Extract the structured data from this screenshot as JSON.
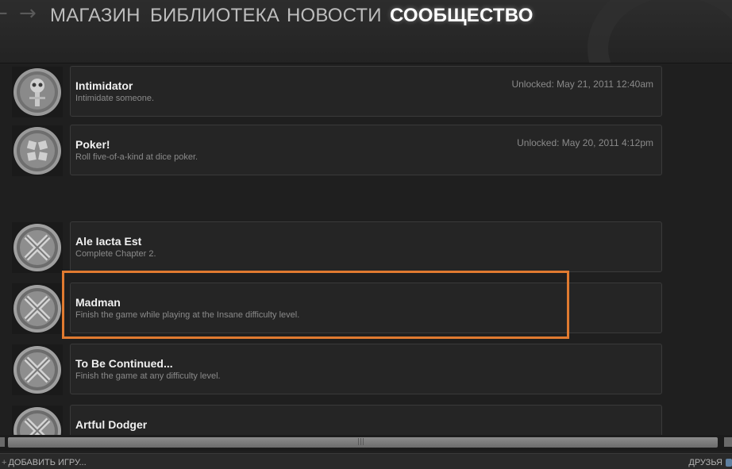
{
  "nav": {
    "back_icon": "←",
    "forward_icon": "→",
    "tabs": [
      {
        "label": "МАГАЗИН",
        "active": false
      },
      {
        "label": "БИБЛИОТЕКА",
        "active": false
      },
      {
        "label": "НОВОСТИ",
        "active": false
      },
      {
        "label": "СООБЩЕСТВО",
        "active": true
      }
    ]
  },
  "achievements": [
    {
      "name": "Intimidator",
      "description": "Intimidate someone.",
      "unlocked": "Unlocked: May 21, 2011 12:40am",
      "icon": "skull-medal-icon"
    },
    {
      "name": "Poker!",
      "description": "Roll five-of-a-kind at dice poker.",
      "unlocked": "Unlocked: May 20, 2011 4:12pm",
      "icon": "dice-medal-icon"
    },
    {
      "name": "Ale Iacta Est",
      "description": "Complete Chapter 2.",
      "unlocked": "",
      "icon": "chapter-medal-icon"
    },
    {
      "name": "Madman",
      "description": "Finish the game while playing at the Insane difficulty level.",
      "unlocked": "",
      "icon": "chapter-medal-icon"
    },
    {
      "name": "To Be Continued...",
      "description": "Finish the game at any difficulty level.",
      "unlocked": "",
      "icon": "chapter-medal-icon"
    },
    {
      "name": "Artful Dodger",
      "description": "",
      "unlocked": "",
      "icon": "chapter-medal-icon"
    }
  ],
  "highlight_color": "#e07a30",
  "bottom": {
    "add_game": "ДОБАВИТЬ ИГРУ...",
    "add_icon": "+",
    "friends": "ДРУЗЬЯ"
  }
}
